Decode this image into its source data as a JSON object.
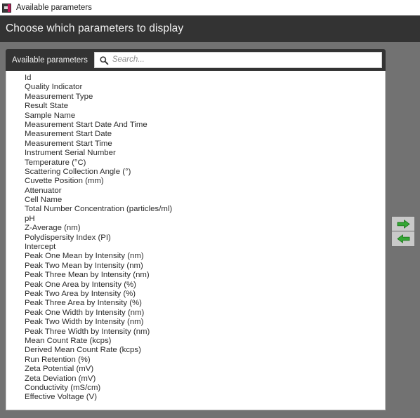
{
  "window": {
    "title": "Available parameters",
    "icon": "app-icon"
  },
  "header": {
    "title": "Choose which parameters to display"
  },
  "panel": {
    "tab_label": "Available parameters",
    "search": {
      "placeholder": "Search...",
      "value": "",
      "icon": "search-icon"
    }
  },
  "transfer": {
    "add_icon": "arrow-right-icon",
    "remove_icon": "arrow-left-icon",
    "arrow_color": "#35a635"
  },
  "parameters": [
    "Id",
    "Quality Indicator",
    "Measurement Type",
    "Result State",
    "Sample Name",
    "Measurement Start Date And Time",
    "Measurement Start Date",
    "Measurement Start Time",
    "Instrument Serial Number",
    "Temperature (°C)",
    "Scattering Collection Angle (°)",
    "Cuvette Position (mm)",
    "Attenuator",
    "Cell Name",
    "Total Number Concentration (particles/ml)",
    "pH",
    "Z-Average (nm)",
    "Polydispersity Index (PI)",
    "Intercept",
    "Peak One Mean by Intensity (nm)",
    "Peak Two Mean by Intensity (nm)",
    "Peak Three Mean by Intensity (nm)",
    "Peak One Area by Intensity (%)",
    "Peak Two Area by Intensity (%)",
    "Peak Three Area by Intensity (%)",
    "Peak One Width by Intensity (nm)",
    "Peak Two Width by Intensity (nm)",
    "Peak Three Width by Intensity (nm)",
    "Mean Count Rate (kcps)",
    "Derived Mean Count Rate (kcps)",
    "Run Retention (%)",
    "Zeta Potential (mV)",
    "Zeta Deviation (mV)",
    "Conductivity (mS/cm)",
    "Effective Voltage (V)"
  ],
  "colors": {
    "header_bg": "#333333",
    "body_bg": "#727272",
    "panel_bg": "#ffffff",
    "accent_green": "#35a635",
    "icon_pink": "#c2185b"
  }
}
